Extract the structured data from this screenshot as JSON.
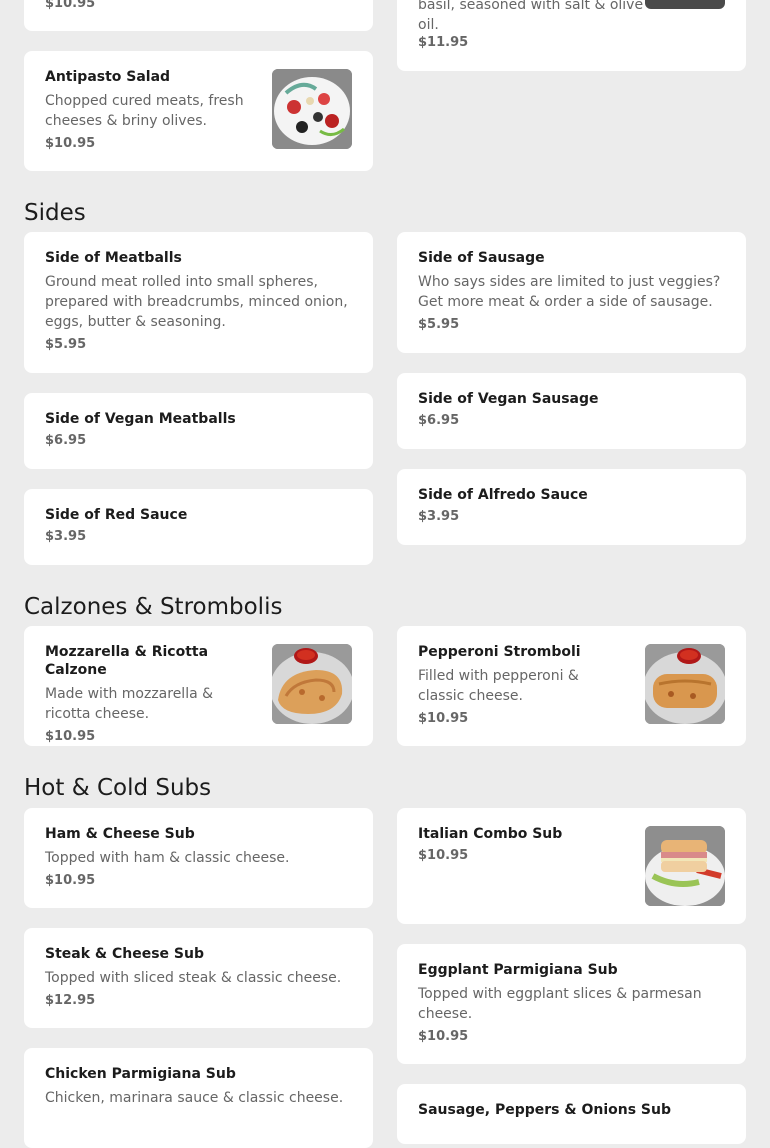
{
  "top_cards": {
    "left_partial": {
      "price": "$10.95"
    },
    "right_partial": {
      "desc": "basil, seasoned with salt & olive oil.",
      "price": "$11.95"
    },
    "antipasto": {
      "name": "Antipasto Salad",
      "desc": "Chopped cured meats, fresh cheeses & briny olives.",
      "price": "$10.95",
      "image_icon": "salad-photo-icon"
    }
  },
  "sections": {
    "sides": {
      "title": "Sides",
      "items": [
        {
          "name": "Side of Meatballs",
          "desc": "Ground meat rolled into small spheres, prepared with breadcrumbs, minced onion, eggs, butter & seasoning.",
          "price": "$5.95"
        },
        {
          "name": "Side of Sausage",
          "desc": "Who says sides are limited to just veggies? Get more meat & order a side of sausage.",
          "price": "$5.95"
        },
        {
          "name": "Side of Vegan Meatballs",
          "price": "$6.95"
        },
        {
          "name": "Side of Vegan Sausage",
          "price": "$6.95"
        },
        {
          "name": "Side of Red Sauce",
          "price": "$3.95"
        },
        {
          "name": "Side of Alfredo Sauce",
          "price": "$3.95"
        }
      ]
    },
    "calzones": {
      "title": "Calzones & Strombolis",
      "items": [
        {
          "name": "Mozzarella & Ricotta Calzone",
          "desc": "Made with mozzarella & ricotta cheese.",
          "price": "$10.95",
          "image_icon": "calzone-photo-icon"
        },
        {
          "name": "Pepperoni Stromboli",
          "desc": "Filled with pepperoni & classic cheese.",
          "price": "$10.95",
          "image_icon": "stromboli-photo-icon"
        }
      ]
    },
    "subs": {
      "title": "Hot & Cold Subs",
      "items": [
        {
          "name": "Ham & Cheese Sub",
          "desc": "Topped with ham & classic cheese.",
          "price": "$10.95"
        },
        {
          "name": "Italian Combo Sub",
          "price": "$10.95",
          "image_icon": "sub-sandwich-photo-icon"
        },
        {
          "name": "Steak & Cheese Sub",
          "desc": "Topped with sliced steak & classic cheese.",
          "price": "$12.95"
        },
        {
          "name": "Eggplant Parmigiana Sub",
          "desc": "Topped with eggplant slices & parmesan cheese.",
          "price": "$10.95"
        },
        {
          "name": "Chicken Parmigiana Sub",
          "desc": "Chicken, marinara sauce & classic cheese."
        },
        {
          "name": "Sausage, Peppers & Onions Sub"
        }
      ]
    }
  },
  "colors": {
    "background": "#ececec",
    "card": "#ffffff",
    "text": "#1c1c1c",
    "muted": "#666666"
  }
}
